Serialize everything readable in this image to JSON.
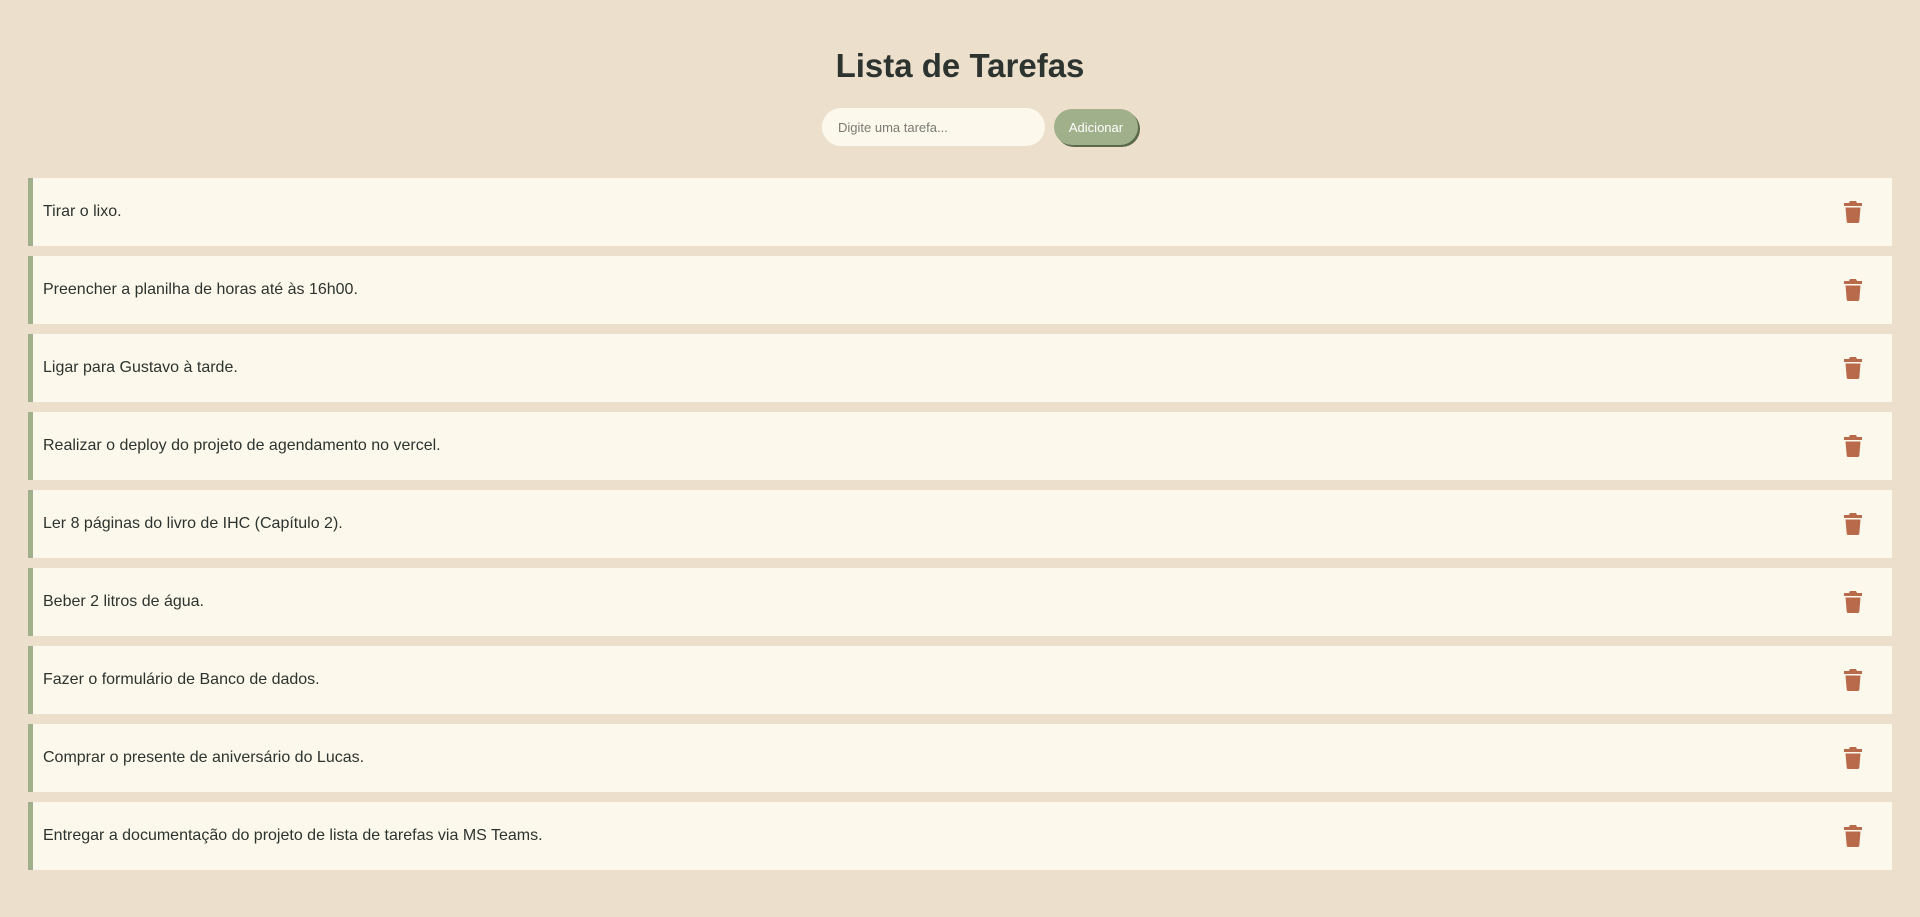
{
  "header": {
    "title": "Lista de Tarefas"
  },
  "form": {
    "input_value": "",
    "input_placeholder": "Digite uma tarefa...",
    "add_label": "Adicionar"
  },
  "tasks": [
    {
      "text": "Tirar o lixo."
    },
    {
      "text": "Preencher a planilha de horas até às 16h00."
    },
    {
      "text": "Ligar para Gustavo à tarde."
    },
    {
      "text": "Realizar o deploy do projeto de agendamento no vercel."
    },
    {
      "text": "Ler 8 páginas do livro de IHC (Capítulo 2)."
    },
    {
      "text": "Beber 2 litros de água."
    },
    {
      "text": "Fazer o formulário de Banco de dados."
    },
    {
      "text": "Comprar o presente de aniversário do Lucas."
    },
    {
      "text": "Entregar a documentação do projeto de lista de tarefas via MS Teams."
    }
  ],
  "icons": {
    "delete": "trash-icon"
  },
  "colors": {
    "background": "#ece0cd",
    "card": "#fcf9ec",
    "accent": "#a0b08a",
    "text": "#2d332e",
    "delete": "#b86a4a"
  }
}
